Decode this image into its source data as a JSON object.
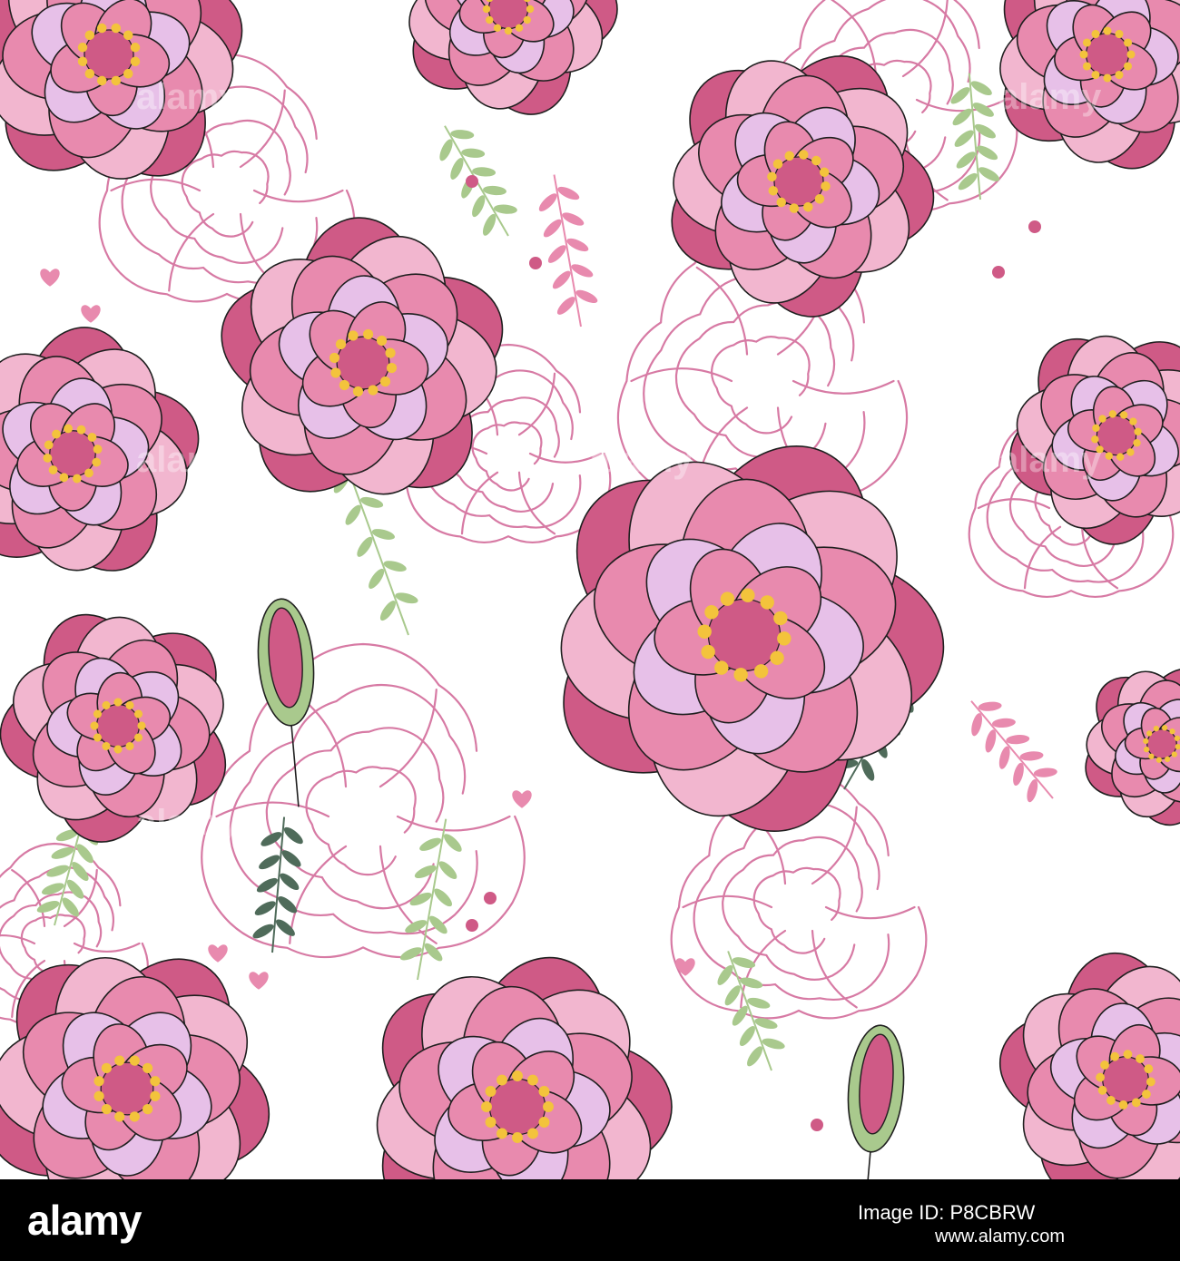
{
  "footer": {
    "logo_text": "alamy",
    "image_id_label": "Image ID: P8CBRW",
    "url": "www.alamy.com"
  },
  "watermark": {
    "text": "alamy"
  },
  "palette": {
    "background": "#ffffff",
    "petal_light": "#f2b6cf",
    "petal_mid": "#e88aae",
    "petal_dark": "#cf5a86",
    "petal_lilac": "#e7c0e8",
    "outline": "#d77aa4",
    "stroke": "#1f1f1f",
    "stamen": "#f3c33c",
    "leaf": "#a9c98d",
    "leaf_dark": "#4f6b5a",
    "footer_bg": "#000000"
  },
  "elements": {
    "flower_icon": "rose-flower-icon",
    "bud_icon": "rose-bud-icon",
    "leaf_icon": "leaf-sprig-icon",
    "heart_icon": "heart-icon"
  }
}
